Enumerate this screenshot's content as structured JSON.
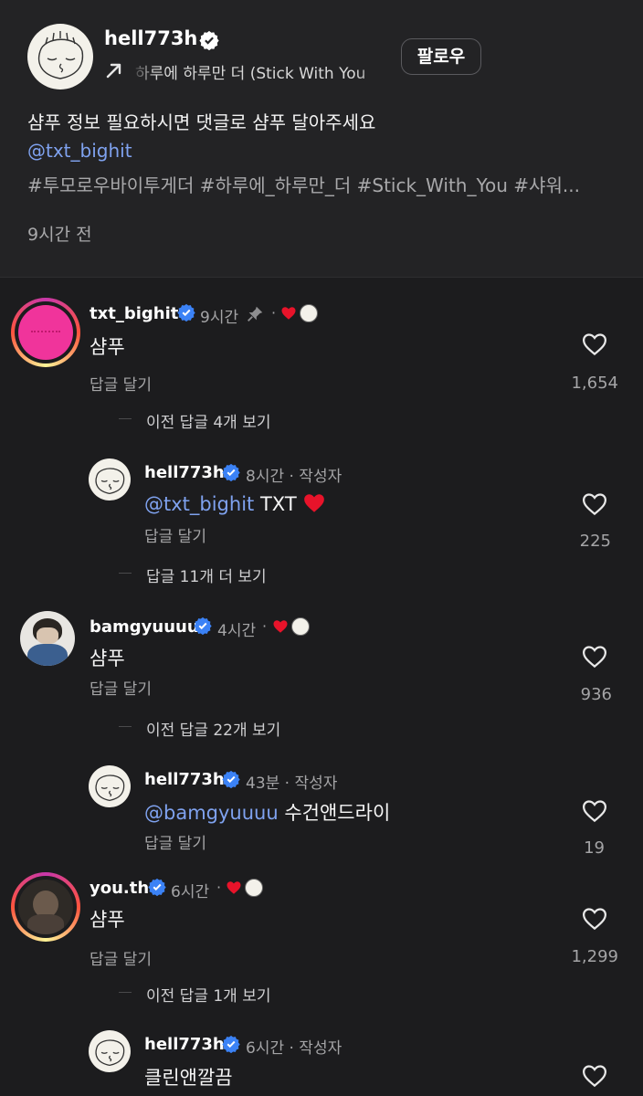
{
  "post": {
    "username": "hell773h",
    "music": "하루에 하루만 더 (Stick With You",
    "follow_label": "팔로우",
    "caption": "샴푸 정보 필요하시면 댓글로 샴푸 달아주세요",
    "mention": "@txt_bighit",
    "hashtags": "#투모로우바이투게더 #하루에_하루만_더 #Stick_With_You #샤워...",
    "time": "9시간 전"
  },
  "comments": [
    {
      "username": "txt_bighit",
      "time": "9시간",
      "text": "샴푸",
      "reply_label": "답글 달기",
      "likes": "1,654",
      "view_more": "이전 답글 4개 보기",
      "reply": {
        "username": "hell773h",
        "meta": "8시간 · 작성자",
        "mention": "@txt_bighit",
        "text": "TXT",
        "reply_label": "답글 달기",
        "likes": "225",
        "view_more": "답글 11개 더 보기"
      }
    },
    {
      "username": "bamgyuuuu",
      "time": "4시간",
      "text": "샴푸",
      "reply_label": "답글 달기",
      "likes": "936",
      "view_more": "이전 답글 22개 보기",
      "reply": {
        "username": "hell773h",
        "meta": "43분 · 작성자",
        "mention": "@bamgyuuuu",
        "text": "수건앤드라이",
        "reply_label": "답글 달기",
        "likes": "19"
      }
    },
    {
      "username": "you.th",
      "time": "6시간",
      "text": "샴푸",
      "reply_label": "답글 달기",
      "likes": "1,299",
      "view_more": "이전 답글 1개 보기",
      "reply": {
        "username": "hell773h",
        "meta": "6시간 · 작성자",
        "text": "클린앤깔끔"
      }
    }
  ],
  "colors": {
    "background": "#1c1c1e",
    "mention": "#7fa2ef",
    "verified": "#3b82f6",
    "heart": "#e8132a"
  },
  "icons": [
    "verified-badge-icon",
    "arrow-up-right-icon",
    "pin-icon",
    "heart-icon",
    "like-heart-icon"
  ]
}
